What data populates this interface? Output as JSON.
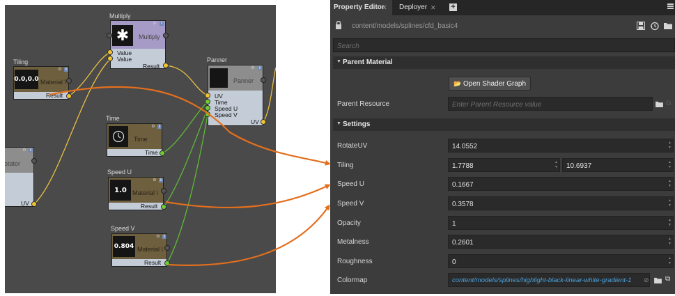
{
  "graph": {
    "multiply": {
      "title": "Multiply",
      "head_label": "Multiply",
      "thumb_symbol": "✱",
      "inputs": [
        "Value",
        "Value"
      ],
      "output": "Result"
    },
    "tiling": {
      "title": "Tiling",
      "thumb_value": "0.0,0.0",
      "head_label": "Material \\",
      "output": "Result"
    },
    "panner": {
      "title": "Panner",
      "head_label": "Panner",
      "inputs": [
        "UV",
        "Time",
        "Speed U",
        "Speed V"
      ],
      "output": "UV"
    },
    "time": {
      "title": "Time",
      "head_label": "Time",
      "output": "Time"
    },
    "rotator": {
      "head_label": "otator",
      "output": "UV"
    },
    "speed_u": {
      "title": "Speed U",
      "thumb_value": "1.0",
      "head_label": "Material \\",
      "output": "Result"
    },
    "speed_v": {
      "title": "Speed V",
      "thumb_value": "0.804",
      "head_label": "Material \\",
      "output": "Result"
    }
  },
  "editor": {
    "tabs": [
      {
        "label": "Property Editor",
        "active": true
      },
      {
        "label": "Deployer",
        "active": false
      }
    ],
    "tab_add": "+",
    "path": "content/models/splines/cfd_basic4",
    "search_placeholder": "Search",
    "parent_material": {
      "header": "Parent Material",
      "open_shader_graph": "Open Shader Graph",
      "parent_resource_label": "Parent Resource",
      "parent_resource_placeholder": "Enter Parent Resource value"
    },
    "settings": {
      "header": "Settings",
      "rotate_uv": {
        "label": "RotateUV",
        "value": "14.0552"
      },
      "tiling": {
        "label": "Tiling",
        "value_x": "1.7788",
        "value_y": "10.6937"
      },
      "speed_u": {
        "label": "Speed U",
        "value": "0.1667"
      },
      "speed_v": {
        "label": "Speed V",
        "value": "0.3578"
      },
      "opacity": {
        "label": "Opacity",
        "value": "1"
      },
      "metalness": {
        "label": "Metalness",
        "value": "0.2601"
      },
      "roughness": {
        "label": "Roughness",
        "value": "0"
      },
      "colormap": {
        "label": "Colormap",
        "value": "content/models/splines/highlight-black-linear-white-gradient-1"
      }
    }
  },
  "colors": {
    "arrow": "#e36f1e",
    "link_yellow": "#e9c042",
    "link_green": "#5fba36",
    "material_head": "#6e5f3e",
    "multiply_head": "#a69ac6",
    "gray_head": "#8d8d8d"
  }
}
